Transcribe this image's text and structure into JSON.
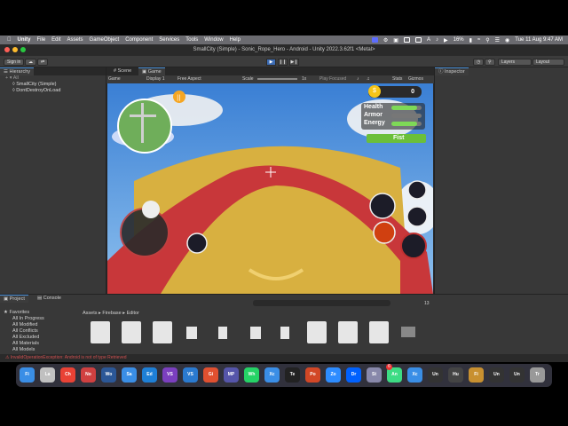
{
  "menubar": {
    "app": "Unity",
    "items": [
      "File",
      "Edit",
      "Assets",
      "GameObject",
      "Component",
      "Services",
      "Tools",
      "Window",
      "Help"
    ],
    "battery": "16%",
    "datetime": "Tue 11 Aug  9:47 AM"
  },
  "window": {
    "title": "SmallCity (Simple) - Sonic_Rope_Hero - Android - Unity 2022.3.62f1 <Metal>"
  },
  "toolbar": {
    "sign_in": "Sign in",
    "layers": "Layers",
    "layout": "Layout"
  },
  "hierarchy": {
    "tab": "Hierarchy",
    "search": "All",
    "items": [
      "SmallCity (Simple)",
      "DontDestroyOnLoad"
    ]
  },
  "scene_tabs": {
    "scene": "Scene",
    "game": "Game"
  },
  "game_toolbar": {
    "mode": "Game",
    "display": "Display 1",
    "aspect": "Free Aspect",
    "scale_label": "Scale",
    "scale_value": "1x",
    "play_focused": "Play Focused",
    "stats": "Stats",
    "gizmos": "Gizmos"
  },
  "inspector": {
    "tab": "Inspector"
  },
  "hud": {
    "coins": "0",
    "health_label": "Health",
    "armor_label": "Armor",
    "energy_label": "Energy",
    "health": 0.85,
    "armor": 0.0,
    "energy": 0.85,
    "weapon": "Fist"
  },
  "project": {
    "tabs": [
      "Project",
      "Console"
    ],
    "favorites": "Favorites",
    "fav_items": [
      "All In Progress",
      "All Modified",
      "All Conflicts",
      "All Excluded",
      "All Materials",
      "All Models"
    ],
    "breadcrumb": [
      "Assets",
      "Firebase",
      "Editor"
    ],
    "count": "13"
  },
  "error": {
    "text": "InvalidOperationException: Android is not of type Retrieved"
  },
  "dock": {
    "apps": [
      "Finder",
      "Launchpad",
      "Chrome",
      "Nova",
      "Word",
      "Safari",
      "Edge",
      "VS",
      "VS Code",
      "Git",
      "MP3",
      "WhatsApp",
      "Xcode",
      "Terminal",
      "PowerPoint",
      "Zoom",
      "Dropbox",
      "Store",
      "Android",
      "Xcode2",
      "Unity",
      "Hub",
      "Files",
      "Unity2",
      "Unity3",
      "Trash"
    ],
    "badge": "6"
  },
  "colors": {
    "accent": "#4a90d9",
    "health": "#7ed957",
    "energy": "#7ed957",
    "error": "#d05050"
  }
}
